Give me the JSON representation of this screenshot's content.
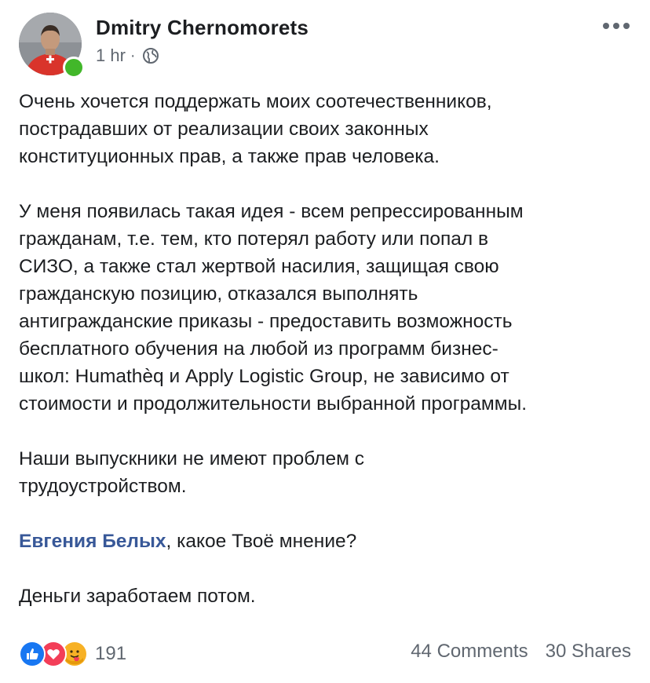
{
  "post": {
    "author": {
      "name": "Dmitry Chernomorets",
      "online": true
    },
    "meta": {
      "time": "1 hr",
      "separator": "·",
      "privacy_icon": "globe-icon"
    },
    "menu_icon": "more-horizontal-icon",
    "paragraphs": [
      "Очень хочется поддержать моих соотечественников,\nпострадавших от реализации своих законных\nконституционных прав, а также прав человека.",
      "У меня появилась такая идея - всем репрессированным\nгражданам, т.е. тем, кто потерял работу или попал в\nСИЗО, а также стал жертвой насилия, защищая свою\nгражданскую позицию, отказался выполнять\nантигражданские приказы - предоставить возможность\nбесплатного обучения на любой из программ бизнес-\nшкол: Humathèq и Apply Logistic Group, не зависимо от\nстоимости и продолжительности выбранной программы.",
      "Наши выпускники не имеют проблем с\nтрудоустройством."
    ],
    "mention": {
      "name": "Евгения Белых",
      "rest": ", какое Твоё мнение?"
    },
    "closing": "Деньги заработаем потом.",
    "reactions": {
      "icons": [
        "like-icon",
        "love-icon",
        "care-icon"
      ],
      "count": "191"
    },
    "comments": "44 Comments",
    "shares": "30 Shares",
    "colors": {
      "text": "#1c1e21",
      "secondary": "#606770",
      "mention": "#385898",
      "online": "#42b72a",
      "like": "#1877f2",
      "love": "#f33e58",
      "care": "#f7b125"
    }
  }
}
